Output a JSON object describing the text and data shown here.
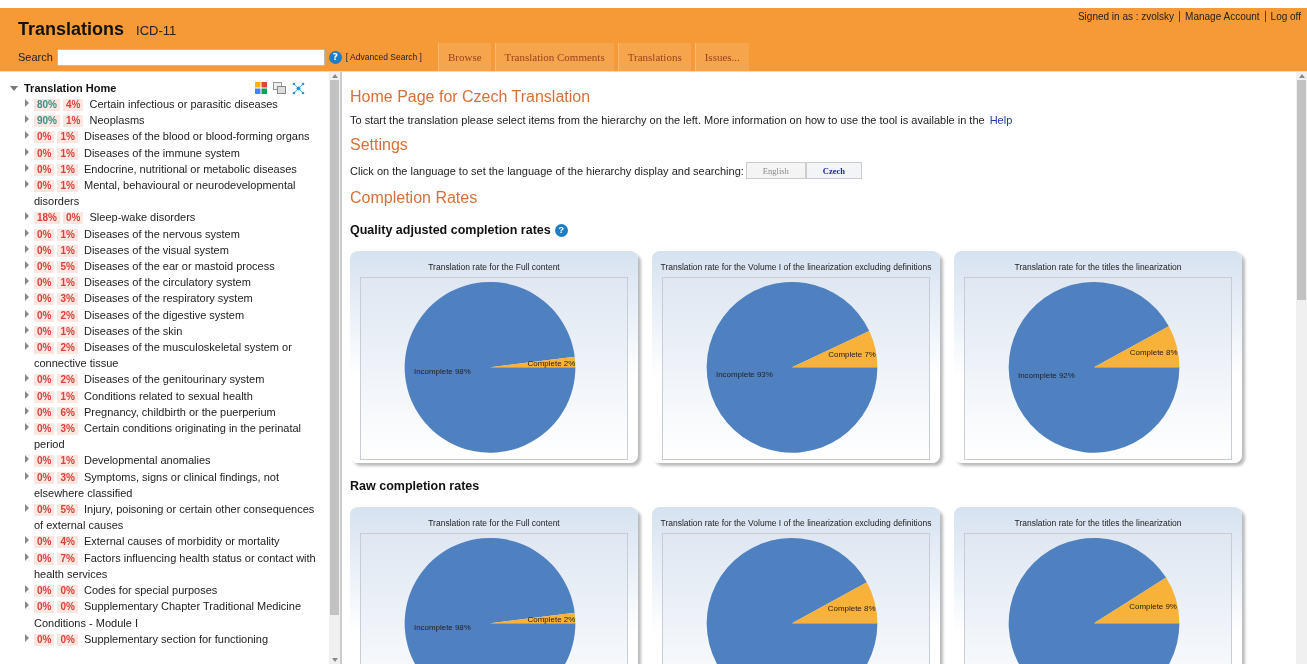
{
  "header": {
    "title": "Translations",
    "subtitle": "ICD-11",
    "search_label": "Search",
    "help_icon": "?",
    "advanced_search": "[ Advanced Search ]",
    "user_links": [
      "Signed in as : zvolsky",
      "Manage Account",
      "Log off"
    ],
    "tabs": [
      "Browse",
      "Translation Comments",
      "Translations",
      "Issues..."
    ]
  },
  "tree": {
    "root": {
      "label": "Translation Home",
      "expanded": true
    },
    "children": [
      {
        "label": "Certain infectious or parasitic diseases",
        "translated": "80%",
        "reviewed": "4%",
        "color": "#3b8f86",
        "expanded": false
      },
      {
        "label": "Neoplasms",
        "translated": "90%",
        "reviewed": "1%",
        "color": "#3b8f86",
        "expanded": false
      },
      {
        "label": "Diseases of the blood or blood-forming organs",
        "translated": "0%",
        "reviewed": "1%",
        "color": "#d9413a",
        "expanded": false
      },
      {
        "label": "Diseases of the immune system",
        "translated": "0%",
        "reviewed": "1%",
        "color": "#d9413a",
        "expanded": false
      },
      {
        "label": "Endocrine, nutritional or metabolic diseases",
        "translated": "0%",
        "reviewed": "1%",
        "color": "#d9413a",
        "expanded": false
      },
      {
        "label": "Mental, behavioural or neurodevelopmental disorders",
        "translated": "0%",
        "reviewed": "1%",
        "color": "#d9413a",
        "expanded": false
      },
      {
        "label": "Sleep-wake disorders",
        "translated": "18%",
        "reviewed": "0%",
        "color": "#d9413a",
        "expanded": false
      },
      {
        "label": "Diseases of the nervous system",
        "translated": "0%",
        "reviewed": "1%",
        "color": "#d9413a",
        "expanded": false
      },
      {
        "label": "Diseases of the visual system",
        "translated": "0%",
        "reviewed": "1%",
        "color": "#d9413a",
        "expanded": false
      },
      {
        "label": "Diseases of the ear or mastoid process",
        "translated": "0%",
        "reviewed": "5%",
        "color": "#d9413a",
        "expanded": false
      },
      {
        "label": "Diseases of the circulatory system",
        "translated": "0%",
        "reviewed": "1%",
        "color": "#d9413a",
        "expanded": false
      },
      {
        "label": "Diseases of the respiratory system",
        "translated": "0%",
        "reviewed": "3%",
        "color": "#d9413a",
        "expanded": false
      },
      {
        "label": "Diseases of the digestive system",
        "translated": "0%",
        "reviewed": "2%",
        "color": "#d9413a",
        "expanded": false
      },
      {
        "label": "Diseases of the skin",
        "translated": "0%",
        "reviewed": "1%",
        "color": "#d9413a",
        "expanded": false
      },
      {
        "label": "Diseases of the musculoskeletal system or connective tissue",
        "translated": "0%",
        "reviewed": "2%",
        "color": "#d9413a",
        "expanded": false
      },
      {
        "label": "Diseases of the genitourinary system",
        "translated": "0%",
        "reviewed": "2%",
        "color": "#d9413a",
        "expanded": false
      },
      {
        "label": "Conditions related to sexual health",
        "translated": "0%",
        "reviewed": "1%",
        "color": "#d9413a",
        "expanded": false
      },
      {
        "label": "Pregnancy, childbirth or the puerperium",
        "translated": "0%",
        "reviewed": "6%",
        "color": "#d9413a",
        "expanded": false
      },
      {
        "label": "Certain conditions originating in the perinatal period",
        "translated": "0%",
        "reviewed": "3%",
        "color": "#d9413a",
        "expanded": false
      },
      {
        "label": "Developmental anomalies",
        "translated": "0%",
        "reviewed": "1%",
        "color": "#d9413a",
        "expanded": false
      },
      {
        "label": "Symptoms, signs or clinical findings, not elsewhere classified",
        "translated": "0%",
        "reviewed": "3%",
        "color": "#d9413a",
        "expanded": false
      },
      {
        "label": "Injury, poisoning or certain other consequences of external causes",
        "translated": "0%",
        "reviewed": "5%",
        "color": "#d9413a",
        "expanded": false
      },
      {
        "label": "External causes of morbidity or mortality",
        "translated": "0%",
        "reviewed": "4%",
        "color": "#d9413a",
        "expanded": false
      },
      {
        "label": "Factors influencing health status or contact with health services",
        "translated": "0%",
        "reviewed": "7%",
        "color": "#d9413a",
        "expanded": false
      },
      {
        "label": "Codes for special purposes",
        "translated": "0%",
        "reviewed": "0%",
        "color": "#d9413a",
        "expanded": false
      },
      {
        "label": "Supplementary Chapter Traditional Medicine Conditions - Module I",
        "translated": "0%",
        "reviewed": "0%",
        "color": "#d9413a",
        "expanded": false
      },
      {
        "label": "Supplementary section for functioning",
        "translated": "0%",
        "reviewed": "0%",
        "color": "#d9413a",
        "expanded": false
      }
    ]
  },
  "main": {
    "heading": "Home Page for Czech Translation",
    "intro": "To start the translation please select items from the hierarchy on the left. More information on how to use the tool is available in the",
    "help_link": "Help",
    "settings_heading": "Settings",
    "language_prompt": "Click on the language to set the language of the hierarchy display and searching:",
    "languages": [
      {
        "label": "English",
        "selected": false
      },
      {
        "label": "Czech",
        "selected": true
      }
    ],
    "completion_heading": "Completion Rates",
    "sections": [
      {
        "title": "Quality adjusted completion rates",
        "help_icon": "?",
        "charts": [
          {
            "chart_data": {
              "type": "pie",
              "title": "Translation rate for the Full content",
              "values": [
                2,
                98
              ],
              "value_labels": [
                "Complete 2%",
                "Incomplete 98%"
              ]
            }
          },
          {
            "chart_data": {
              "type": "pie",
              "title": "Translation rate for the Volume I of the linearization excluding definitions",
              "values": [
                7,
                93
              ],
              "value_labels": [
                "Complete 7%",
                "Incomplete 93%"
              ]
            }
          },
          {
            "chart_data": {
              "type": "pie",
              "title": "Translation rate for the titles the linearization",
              "values": [
                8,
                92
              ],
              "value_labels": [
                "Complete 8%",
                "Incomplete 92%"
              ]
            }
          }
        ]
      },
      {
        "title": "Raw completion rates",
        "charts": [
          {
            "chart_data": {
              "type": "pie",
              "title": "Translation rate for the Full content",
              "values": [
                2,
                98
              ],
              "value_labels": [
                "Complete 2%",
                "Incomplete 98%"
              ]
            }
          },
          {
            "chart_data": {
              "type": "pie",
              "title": "Translation rate for the Volume I of the linearization excluding definitions",
              "values": [
                8,
                92
              ],
              "value_labels": [
                "Complete 8%",
                null
              ]
            }
          },
          {
            "chart_data": {
              "type": "pie",
              "title": "Translation rate for the titles the linearization",
              "values": [
                9,
                91
              ],
              "value_labels": [
                "Complete 9%",
                null
              ]
            }
          }
        ]
      }
    ]
  }
}
